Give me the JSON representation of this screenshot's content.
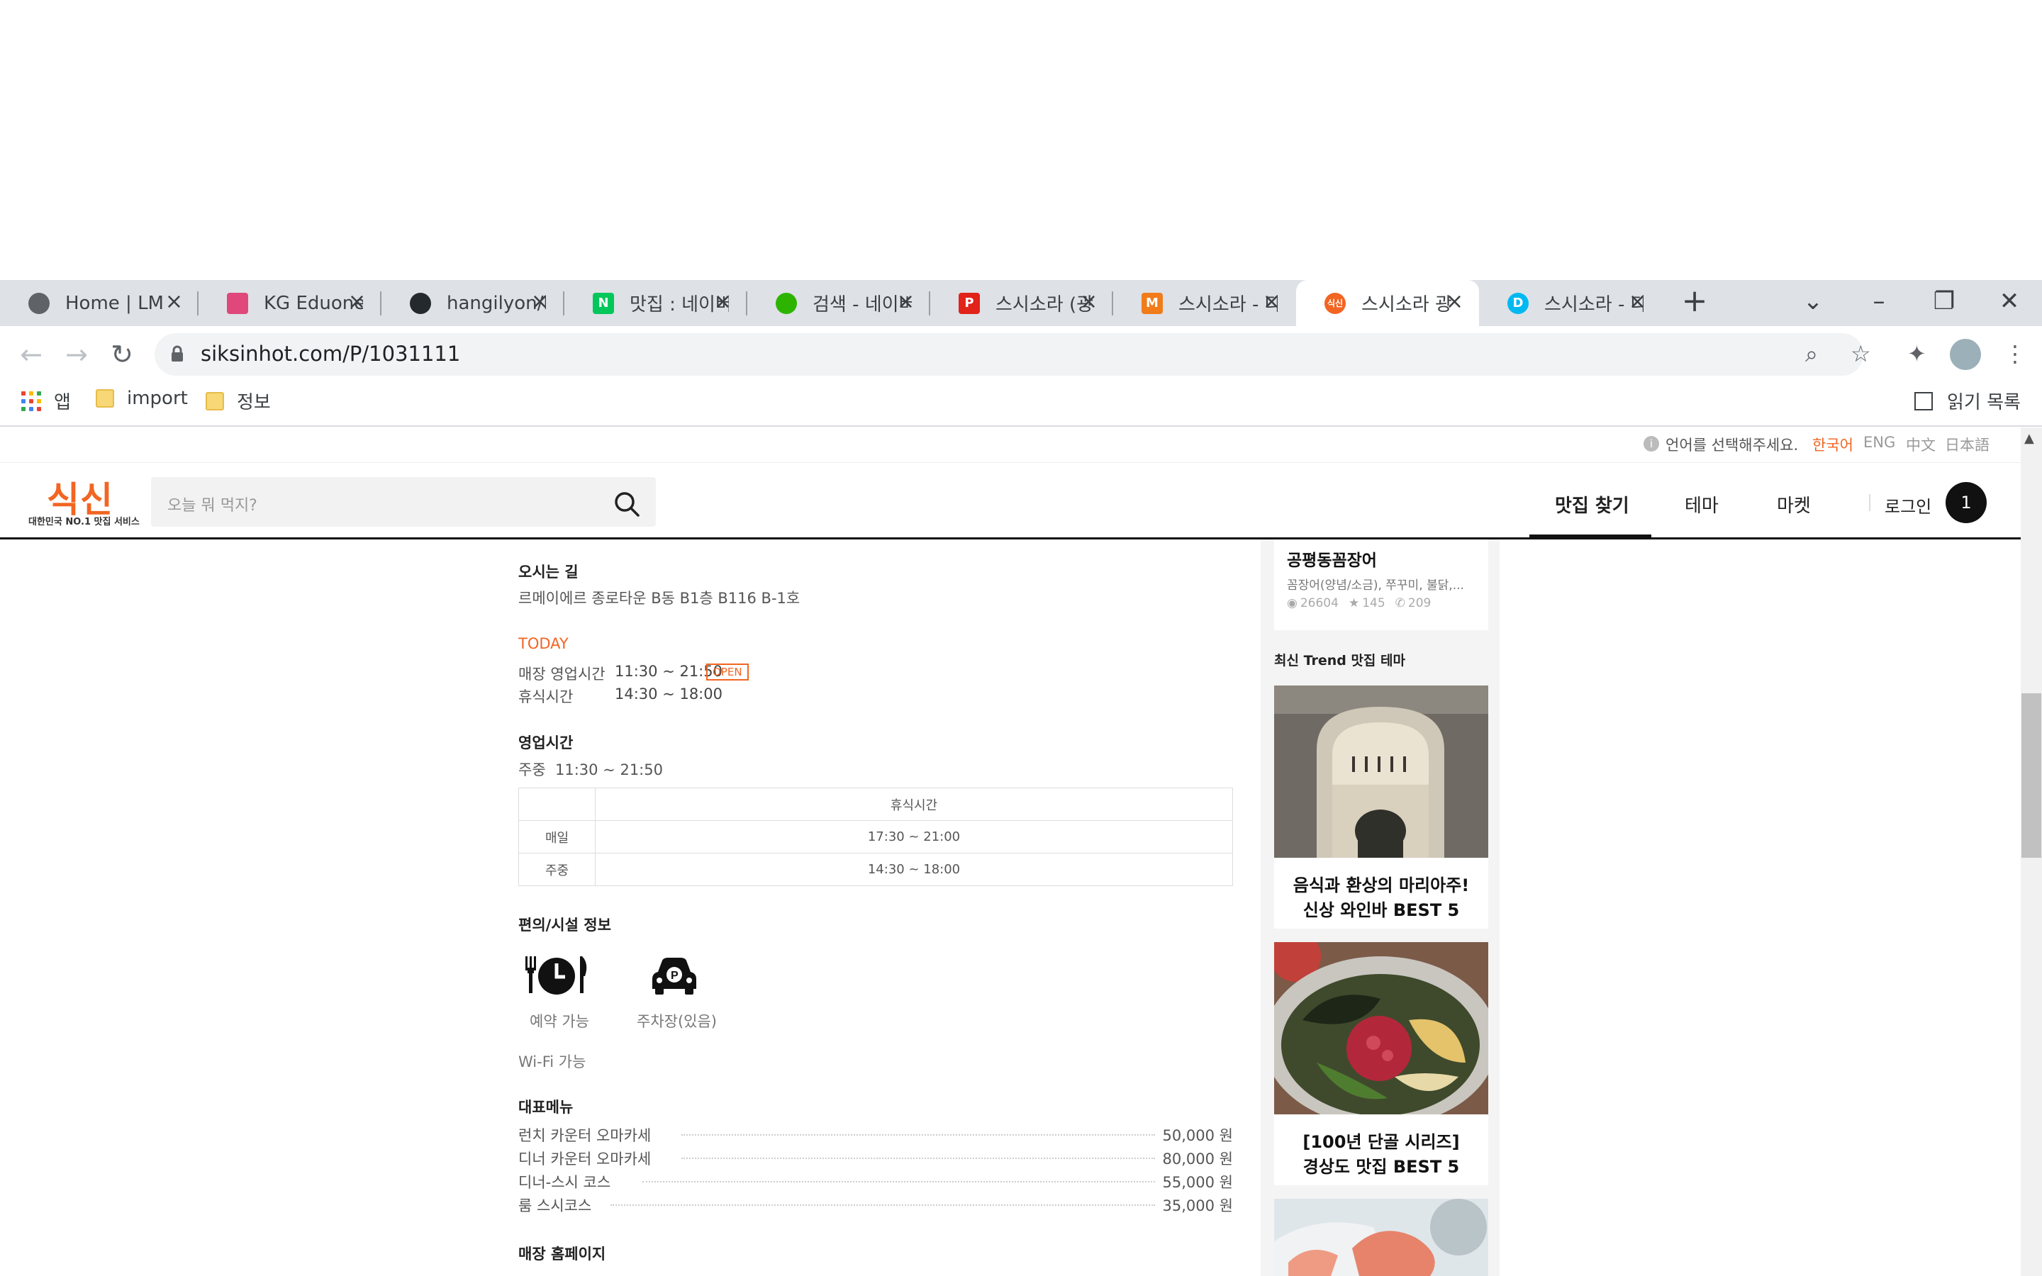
{
  "browser": {
    "tabs": [
      {
        "title": "Home | LMS",
        "favicon": "globe-icon",
        "color": "#5f6368"
      },
      {
        "title": "KG Eduone",
        "favicon": "kg-eduone-icon",
        "color": "#e0487b"
      },
      {
        "title": "hangilyon/b",
        "favicon": "github-icon",
        "color": "#24292e"
      },
      {
        "title": "맛집 : 네이버",
        "favicon": "naver-icon",
        "color": "#03c75a"
      },
      {
        "title": "검색 - 네이버",
        "favicon": "naver-map-icon",
        "color": "#2db400"
      },
      {
        "title": "스시소라 (광",
        "favicon": "p-icon",
        "color": "#e2231a"
      },
      {
        "title": "스시소라 - 다",
        "favicon": "mango-icon",
        "color": "#f27b1a"
      },
      {
        "title": "스시소라 광",
        "favicon": "siksin-icon",
        "color": "#f26522"
      },
      {
        "title": "스시소라 - 다",
        "favicon": "d-icon",
        "color": "#00b9f1"
      }
    ],
    "url": "siksinhot.com/P/1031111",
    "bookmarks": {
      "apps": "앱",
      "items": [
        "import",
        "정보"
      ],
      "reading_list": "읽기 목록"
    }
  },
  "lang_bar": {
    "prompt": "언어를 선택해주세요.",
    "options": [
      "한국어",
      "ENG",
      "中文",
      "日本語"
    ],
    "active_color": "#f26522"
  },
  "header": {
    "logo": "식신",
    "logo_sub": "대한민국 NO.1 맛집 서비스",
    "search_placeholder": "오늘 뭐 먹지?",
    "nav": [
      "맛집 찾기",
      "테마",
      "마켓"
    ],
    "login": "로그인",
    "cart_count": "1"
  },
  "main": {
    "directions_title": "오시는 길",
    "directions": "르메이에르 종로타운 B동 B1층 B116 B-1호",
    "today_label": "TODAY",
    "today_rows": [
      {
        "label": "매장 영업시간",
        "value": "11:30 ~ 21:50",
        "badge": "OPEN"
      },
      {
        "label": "휴식시간",
        "value": "14:30 ~ 18:00"
      }
    ],
    "hours_title": "영업시간",
    "hours_summary": "주중  11:30 ~ 21:50",
    "break_table": {
      "header": "휴식시간",
      "rows": [
        {
          "day": "매일",
          "time": "17:30 ~ 21:00"
        },
        {
          "day": "주중",
          "time": "14:30 ~ 18:00"
        }
      ]
    },
    "facilities_title": "편의/시설 정보",
    "facilities": [
      {
        "label": "예약 가능",
        "icon": "reservation-icon"
      },
      {
        "label": "주차장(있음)",
        "icon": "parking-icon"
      }
    ],
    "wifi": "Wi-Fi 가능",
    "menu_title": "대표메뉴",
    "menu": [
      {
        "name": "런치 카운터 오마카세",
        "price": "50,000 원"
      },
      {
        "name": "디너 카운터 오마카세",
        "price": "80,000 원"
      },
      {
        "name": "디너-스시 코스",
        "price": "55,000 원"
      },
      {
        "name": "룸 스시코스",
        "price": "35,000 원"
      }
    ],
    "homepage_title": "매장 홈페이지"
  },
  "side": {
    "top_card": {
      "name": "공평동꼼장어",
      "desc": "꼼장어(양념/소금), 쭈꾸미, 불닭,...",
      "views": "26604",
      "stars": "145",
      "calls": "209"
    },
    "trend_title": "최신 Trend 맛집 테마",
    "cards": [
      {
        "line1": "음식과 환상의 마리아주!",
        "line2": "신상 와인바 BEST 5"
      },
      {
        "line1": "[100년 단골 시리즈]",
        "line2": "경상도 맛집 BEST 5"
      }
    ]
  }
}
